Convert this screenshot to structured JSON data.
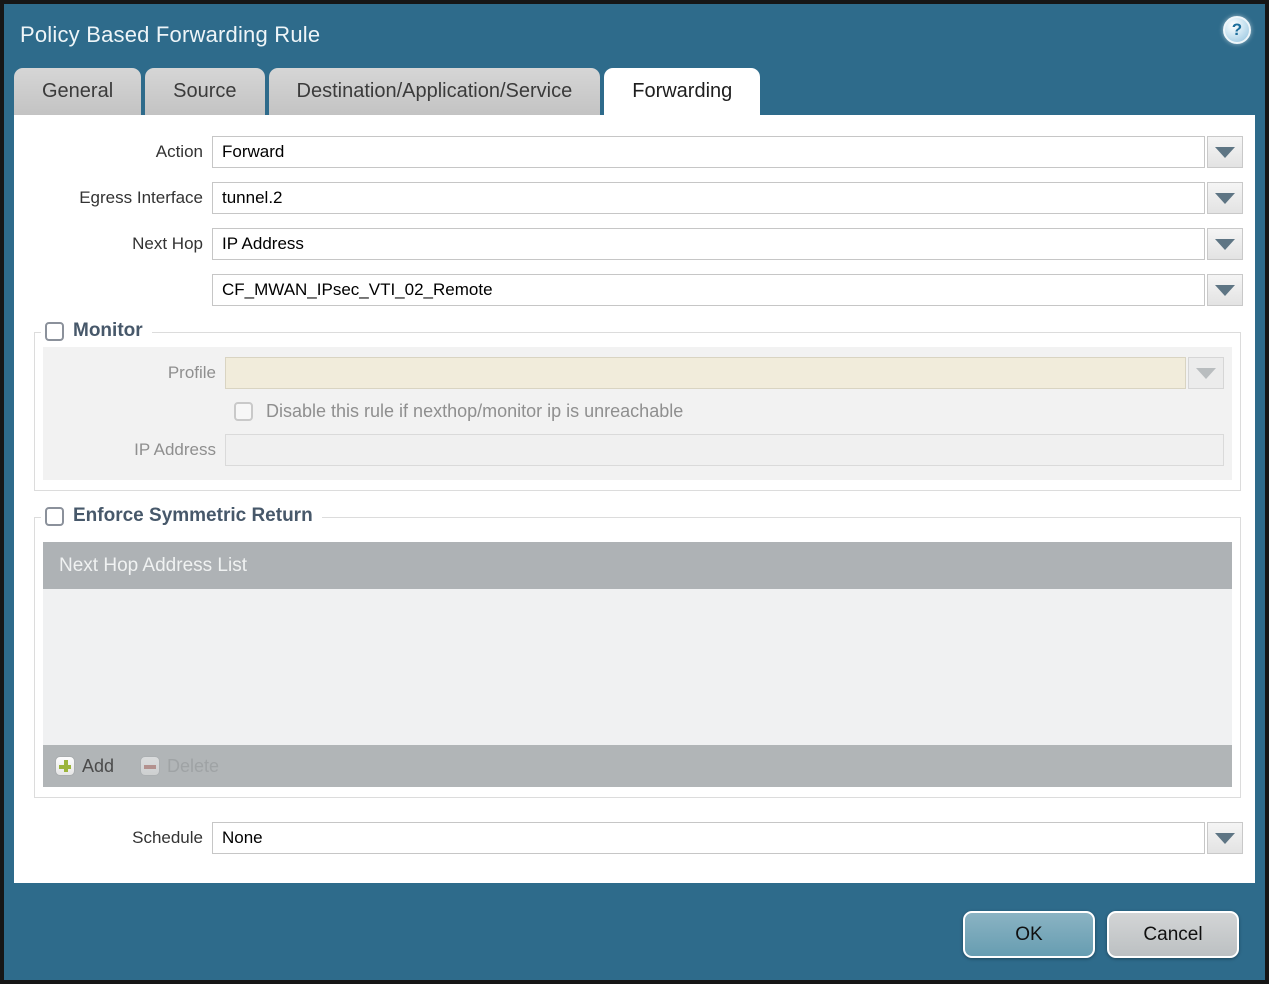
{
  "dialog": {
    "title": "Policy Based Forwarding Rule",
    "help_glyph": "?"
  },
  "tabs": [
    {
      "label": "General",
      "active": false
    },
    {
      "label": "Source",
      "active": false
    },
    {
      "label": "Destination/Application/Service",
      "active": false
    },
    {
      "label": "Forwarding",
      "active": true
    }
  ],
  "form": {
    "action": {
      "label": "Action",
      "value": "Forward"
    },
    "egress_interface": {
      "label": "Egress Interface",
      "value": "tunnel.2"
    },
    "next_hop": {
      "label": "Next Hop",
      "value": "IP Address"
    },
    "next_hop_address": {
      "value": "CF_MWAN_IPsec_VTI_02_Remote"
    },
    "schedule": {
      "label": "Schedule",
      "value": "None"
    }
  },
  "monitor": {
    "legend": "Monitor",
    "checked": false,
    "profile": {
      "label": "Profile",
      "value": ""
    },
    "disable_rule": {
      "label": "Disable this rule if nexthop/monitor ip is unreachable",
      "checked": false
    },
    "ip_address": {
      "label": "IP Address",
      "value": ""
    }
  },
  "symmetric_return": {
    "legend": "Enforce Symmetric Return",
    "checked": false,
    "table": {
      "header": "Next Hop Address List",
      "rows": []
    },
    "add_label": "Add",
    "delete_label": "Delete"
  },
  "footer": {
    "ok_label": "OK",
    "cancel_label": "Cancel"
  },
  "colors": {
    "titlebar_bg": "#2e6b8b",
    "tab_inactive_bg": "#c9c9c9",
    "active_tab_bg": "#ffffff",
    "disabled_field_bg": "#f1ecdb",
    "table_header_bg": "#aeb2b5",
    "table_footer_bg": "#b1b5b7",
    "ok_button_bg": "#72a4b7",
    "cancel_button_bg": "#c5c8ca",
    "add_icon_green": "#9cb53c",
    "delete_icon_red": "#b5746d",
    "legend_text": "#47586a"
  }
}
